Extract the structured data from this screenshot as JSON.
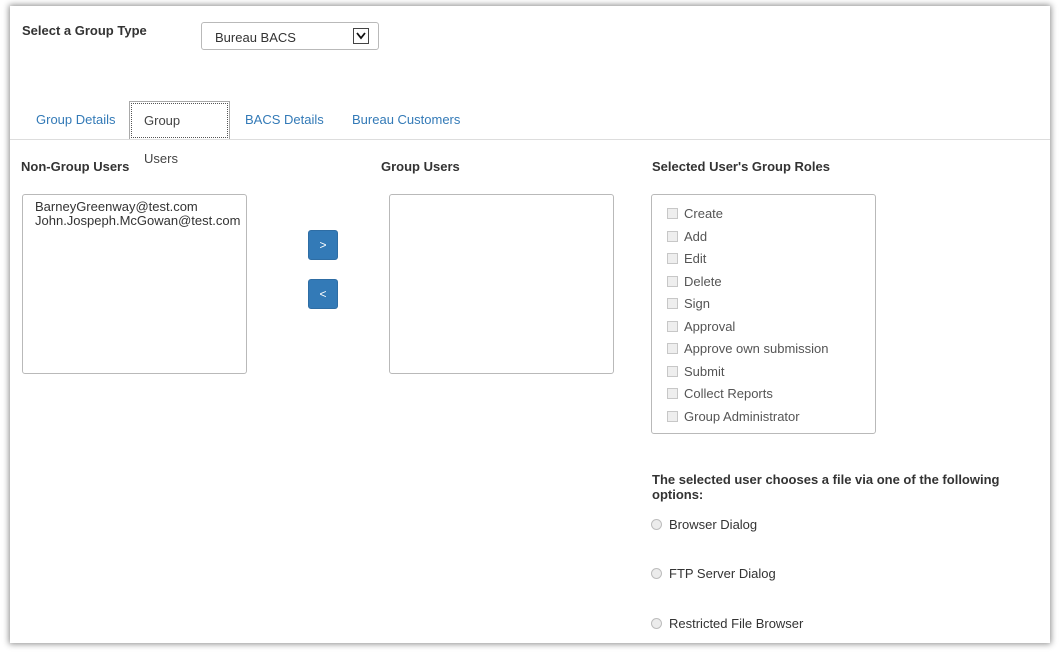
{
  "group_type": {
    "label": "Select a Group Type",
    "selected": "Bureau BACS"
  },
  "tabs": [
    {
      "label": "Group Details",
      "active": false
    },
    {
      "label": "Group Users",
      "active": true
    },
    {
      "label": "BACS Details",
      "active": false
    },
    {
      "label": "Bureau Customers",
      "active": false
    }
  ],
  "non_group_users": {
    "heading": "Non-Group Users",
    "items": [
      "BarneyGreenway@test.com",
      "John.Jospeph.McGowan@test.com"
    ]
  },
  "buttons": {
    "add": ">",
    "remove": "<"
  },
  "group_users": {
    "heading": "Group Users",
    "items": []
  },
  "roles": {
    "heading": "Selected User's Group Roles",
    "items": [
      "Create",
      "Add",
      "Edit",
      "Delete",
      "Sign",
      "Approval",
      "Approve own submission",
      "Submit",
      "Collect Reports",
      "Group Administrator"
    ]
  },
  "file_options": {
    "heading": "The selected user chooses a file via one of the following options:",
    "options": [
      "Browser Dialog",
      "FTP Server Dialog",
      "Restricted File Browser"
    ]
  },
  "colors": {
    "link": "#337ab7",
    "primary_button": "#337ab7"
  }
}
